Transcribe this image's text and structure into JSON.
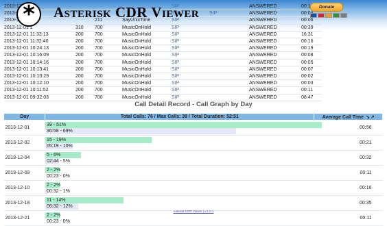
{
  "header": {
    "title": "Asterisk CDR Viewer",
    "logo_glyph": "*",
    "donate_label": "Donate",
    "card_colors": [
      "#1a4fa0",
      "#d6262d",
      "#f0a020",
      "#3b8a3b",
      "#7a7a7a"
    ]
  },
  "cdr_rows": [
    {
      "date": "2013-12-01 1",
      "src": "",
      "dst": "",
      "app": "",
      "chan": "SIP",
      "extra": "",
      "disp": "ANSWERED",
      "dur": "00:13"
    },
    {
      "date": "2013-12-01 1",
      "src": "",
      "dst": "",
      "app": "",
      "chan": "SIP",
      "extra": "SIP",
      "disp": "ANSWERED",
      "dur": "00:04"
    },
    {
      "date": "2013-12-01 1",
      "src": "",
      "dst": "211",
      "app": "SayUnixTime",
      "chan": "SIP",
      "extra": "",
      "disp": "ANSWERED",
      "dur": "00:06"
    },
    {
      "date": "2013-12-01 1",
      "src": "310",
      "dst": "700",
      "app": "MusicOnHold",
      "chan": "SIP",
      "extra": "",
      "disp": "ANSWERED",
      "dur": "00:39"
    },
    {
      "date": "2013-12-01 11:33:13",
      "src": "200",
      "dst": "700",
      "app": "MusicOnHold",
      "chan": "SIP",
      "extra": "",
      "disp": "ANSWERED",
      "dur": "16:31"
    },
    {
      "date": "2013-12-01 11:32:40",
      "src": "200",
      "dst": "700",
      "app": "MusicOnHold",
      "chan": "SIP",
      "extra": "",
      "disp": "ANSWERED",
      "dur": "00:16"
    },
    {
      "date": "2013-12-01 10:24:13",
      "src": "200",
      "dst": "700",
      "app": "MusicOnHold",
      "chan": "SIP",
      "extra": "",
      "disp": "ANSWERED",
      "dur": "00:19"
    },
    {
      "date": "2013-12-01 10:16:09",
      "src": "200",
      "dst": "700",
      "app": "MusicOnHold",
      "chan": "SIP",
      "extra": "",
      "disp": "ANSWERED",
      "dur": "00:08"
    },
    {
      "date": "2013-12-01 10:14:16",
      "src": "200",
      "dst": "700",
      "app": "MusicOnHold",
      "chan": "SIP",
      "extra": "",
      "disp": "ANSWERED",
      "dur": "00:05"
    },
    {
      "date": "2013-12-01 10:13:41",
      "src": "200",
      "dst": "700",
      "app": "MusicOnHold",
      "chan": "SIP",
      "extra": "",
      "disp": "ANSWERED",
      "dur": "00:07"
    },
    {
      "date": "2013-12-01 10:13:29",
      "src": "200",
      "dst": "700",
      "app": "MusicOnHold",
      "chan": "SIP",
      "extra": "",
      "disp": "ANSWERED",
      "dur": "00:02"
    },
    {
      "date": "2013-12-01 10:12:10",
      "src": "200",
      "dst": "700",
      "app": "MusicOnHold",
      "chan": "SIP",
      "extra": "",
      "disp": "ANSWERED",
      "dur": "00:03"
    },
    {
      "date": "2013-12-01 10:11:52",
      "src": "200",
      "dst": "700",
      "app": "MusicOnHold",
      "chan": "SIP",
      "extra": "",
      "disp": "ANSWERED",
      "dur": "00:11"
    },
    {
      "date": "2013-12-01 09:32:03",
      "src": "200",
      "dst": "700",
      "app": "MusicOnHold",
      "chan": "SIP",
      "extra": "",
      "disp": "ANSWERED",
      "dur": "08:47"
    }
  ],
  "graph": {
    "title": "Call Detail Record - Call Graph by Day",
    "col_day": "Day",
    "col_summary": "Total Calls: 76 / Max Calls: 39 / Total Duration: 52:51",
    "col_avg": "Average Call Time",
    "sort_icons": [
      "sort-down-icon",
      "sort-up-icon"
    ],
    "rows": [
      {
        "day": "2013-12-01",
        "calls_label": "39 - 51%",
        "calls_fraction": 1.0,
        "dur_label": "36:58 - 69%",
        "dur_fraction": 0.69,
        "avg": "00:56"
      },
      {
        "day": "2013-12-02",
        "calls_label": "15 - 19%",
        "calls_fraction": 0.385,
        "dur_label": "05:19 - 10%",
        "dur_fraction": 0.1,
        "avg": "00:21"
      },
      {
        "day": "2013-12-04",
        "calls_label": "5 - 6%",
        "calls_fraction": 0.128,
        "dur_label": "02:44 - 5%",
        "dur_fraction": 0.05,
        "avg": "00:32"
      },
      {
        "day": "2013-12-09",
        "calls_label": "2 - 2%",
        "calls_fraction": 0.051,
        "dur_label": "00:23 - 0%",
        "dur_fraction": 0.0,
        "avg": "00:11"
      },
      {
        "day": "2013-12-10",
        "calls_label": "2 - 2%",
        "calls_fraction": 0.051,
        "dur_label": "00:32 - 1%",
        "dur_fraction": 0.01,
        "avg": "00:16"
      },
      {
        "day": "2013-12-18",
        "calls_label": "11 - 14%",
        "calls_fraction": 0.282,
        "dur_label": "06:32 - 12%",
        "dur_fraction": 0.12,
        "avg": "00:35"
      },
      {
        "day": "2013-12-21",
        "calls_label": "2 - 2%",
        "calls_fraction": 0.051,
        "dur_label": "00:23 - 0%",
        "dur_fraction": 0.0,
        "avg": "00:11"
      }
    ]
  },
  "footer": {
    "link": "Asterisk CDR Viewer | v.1.0.1"
  }
}
